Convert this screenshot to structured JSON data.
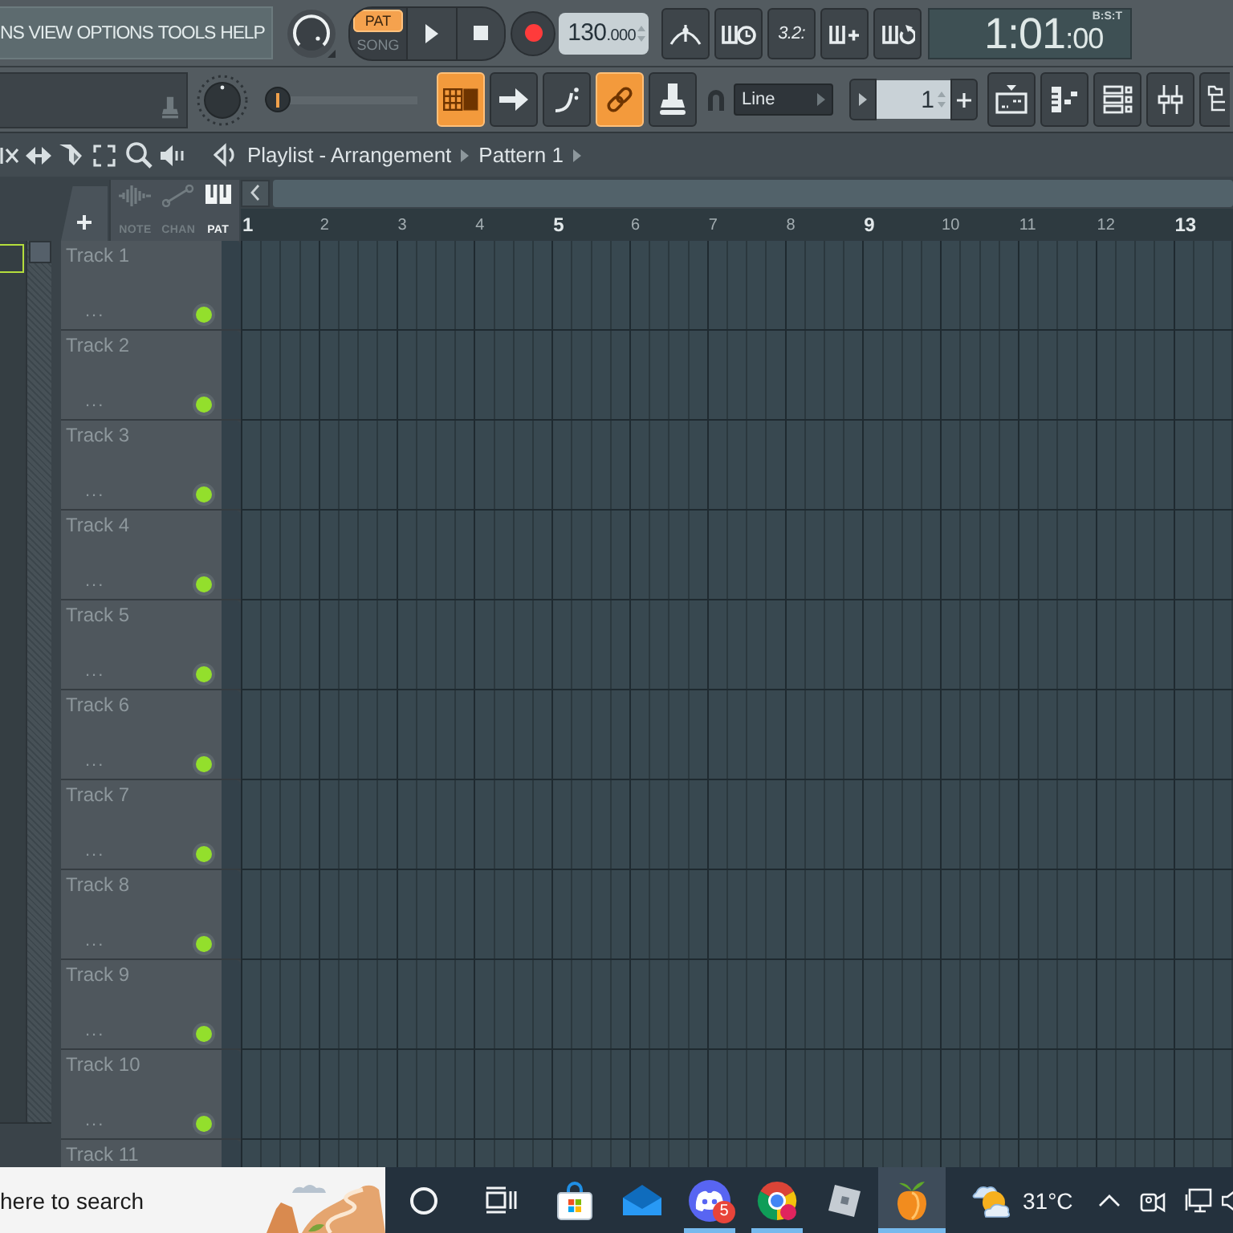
{
  "menu": {
    "items": [
      "NS",
      "VIEW",
      "OPTIONS",
      "TOOLS",
      "HELP"
    ]
  },
  "transport": {
    "modes": [
      {
        "label": "PAT",
        "selected": true
      },
      {
        "label": "SONG",
        "selected": false
      }
    ],
    "tempo": "130",
    "tempo_decimals": ".000"
  },
  "countdown": "3.2:",
  "clock": {
    "time": "1:01",
    "ticks": ":00",
    "format": "B:S:T"
  },
  "position_slider": {
    "level": 0
  },
  "view_buttons": [
    {
      "on": true
    },
    {
      "on": false
    },
    {
      "on": false
    },
    {
      "on": true
    },
    {
      "on": false
    }
  ],
  "snap": {
    "value": "Line"
  },
  "pattern_selector": {
    "value": "1"
  },
  "playlist": {
    "title": "Playlist - Arrangement",
    "pattern": "Pattern 1",
    "clip_tabs": [
      {
        "label": "NOTE",
        "selected": false
      },
      {
        "label": "CHAN",
        "selected": false
      },
      {
        "label": "PAT",
        "selected": true
      }
    ],
    "ruler": [
      "1",
      "2",
      "3",
      "4",
      "5",
      "6",
      "7",
      "8",
      "9",
      "10",
      "11",
      "12",
      "13"
    ],
    "tracks": [
      {
        "name": "Track 1",
        "more": "...",
        "on": true
      },
      {
        "name": "Track 2",
        "more": "...",
        "on": true
      },
      {
        "name": "Track 3",
        "more": "...",
        "on": true
      },
      {
        "name": "Track 4",
        "more": "...",
        "on": true
      },
      {
        "name": "Track 5",
        "more": "...",
        "on": true
      },
      {
        "name": "Track 6",
        "more": "...",
        "on": true
      },
      {
        "name": "Track 7",
        "more": "...",
        "on": true
      },
      {
        "name": "Track 8",
        "more": "...",
        "on": true
      },
      {
        "name": "Track 9",
        "more": "...",
        "on": true
      },
      {
        "name": "Track 10",
        "more": "...",
        "on": true
      },
      {
        "name": "Track 11"
      }
    ]
  },
  "taskbar": {
    "search": {
      "placeholder": "here to search"
    },
    "apps": [
      {
        "running": false,
        "active": false
      },
      {
        "running": false,
        "active": false
      },
      {
        "running": true,
        "active": false,
        "badge": "5"
      },
      {
        "running": true,
        "active": false
      },
      {
        "running": false,
        "active": false
      },
      {
        "running": true,
        "active": true
      }
    ],
    "weather": "31°C"
  }
}
